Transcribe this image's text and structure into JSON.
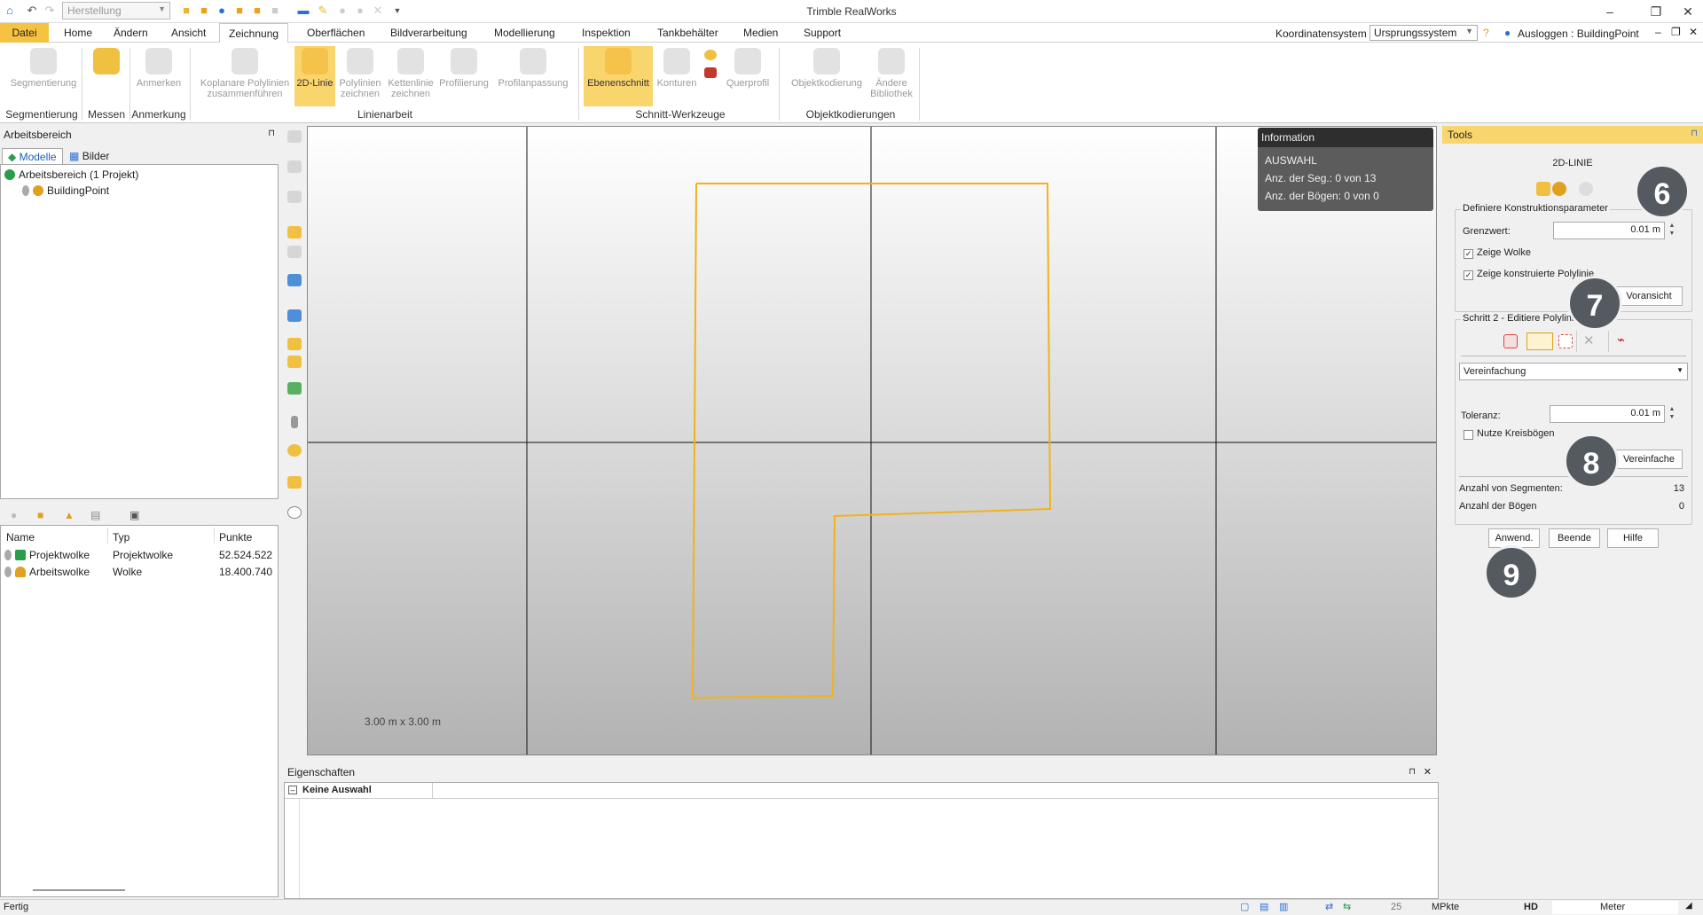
{
  "app": {
    "title": "Trimble RealWorks",
    "quick_combo": "Herstellung"
  },
  "menu": {
    "items": [
      "Datei",
      "Home",
      "Ändern",
      "Ansicht",
      "Zeichnung",
      "Oberflächen",
      "Bildverarbeitung",
      "Modellierung",
      "Inspektion",
      "Tankbehälter",
      "Medien",
      "Support"
    ],
    "coord_label": "Koordinatensystem",
    "coord_value": "Ursprungssystem",
    "logout": "Ausloggen : BuildingPoint"
  },
  "ribbon": {
    "buttons": {
      "segmentierung": "Segmentierung",
      "messen": "",
      "anmerken": "Anmerken",
      "koplanare_1": "Koplanare Polylinien",
      "koplanare_2": "zusammenführen",
      "line2d": "2D-Linie",
      "polylinien_1": "Polylinien",
      "polylinien_2": "zeichnen",
      "kettenlinie_1": "Kettenlinie",
      "kettenlinie_2": "zeichnen",
      "profilierung": "Profilierung",
      "profilanpassung": "Profilanpassung",
      "ebenenschnitt": "Ebenenschnitt",
      "konturen": "Konturen",
      "querprofil": "Querprofil",
      "objektkodierung": "Objektkodierung",
      "andere_1": "Ändere",
      "andere_2": "Bibliothek"
    },
    "groups": {
      "segmentierung": "Segmentierung",
      "messen": "Messen",
      "anmerkung": "Anmerkung",
      "linienarbeit": "Linienarbeit",
      "schnitt": "Schnitt-Werkzeuge",
      "objekt": "Objektkodierungen"
    }
  },
  "workspace": {
    "title": "Arbeitsbereich",
    "tabs": [
      "Modelle",
      "Bilder"
    ],
    "tree": {
      "root": "Arbeitsbereich (1 Projekt)",
      "child": "BuildingPoint"
    },
    "list": {
      "headers": [
        "Name",
        "Typ",
        "Punkte"
      ],
      "rows": [
        {
          "name": "Projektwolke",
          "typ": "Projektwolke",
          "punkte": "52.524.522"
        },
        {
          "name": "Arbeitswolke",
          "typ": "Wolke",
          "punkte": "18.400.740"
        }
      ]
    }
  },
  "viewport": {
    "scale": "3.00 m x 3.00 m",
    "info": {
      "title": "Information",
      "section": "AUSWAHL",
      "segments": "Anz. der Seg.: 0 von 13",
      "arcs": "Anz. der Bögen: 0 von 0"
    },
    "polyline_color": "#f2b21a"
  },
  "properties": {
    "title": "Eigenschaften",
    "row": "Keine Auswahl"
  },
  "tools": {
    "title": "Tools",
    "subtitle": "2D-LINIE",
    "group1": {
      "legend": "Definiere Konstruktionsparameter",
      "grenzwert_label": "Grenzwert:",
      "grenzwert_value": "0.01 m",
      "zeige_wolke": "Zeige Wolke",
      "zeige_polylinie": "Zeige konstruierte Polylinie",
      "voransicht": "Voransicht"
    },
    "group2": {
      "legend": "Schritt 2 - Editiere Polylinie",
      "mode": "Vereinfachung",
      "toleranz_label": "Toleranz:",
      "toleranz_value": "0.01 m",
      "kreisboegen": "Nutze Kreisbögen",
      "vereinfache": "Vereinfache",
      "seg_label": "Anzahl von Segmenten:",
      "seg_value": "13",
      "bog_label": "Anzahl der Bögen",
      "bog_value": "0"
    },
    "buttons": {
      "apply": "Anwend.",
      "finish": "Beende",
      "help": "Hilfe"
    },
    "markers": [
      "6",
      "7",
      "8",
      "9"
    ]
  },
  "status": {
    "left": "Fertig",
    "num": "25",
    "unit1": "MPkte",
    "hd": "HD",
    "unit2": "Meter"
  }
}
